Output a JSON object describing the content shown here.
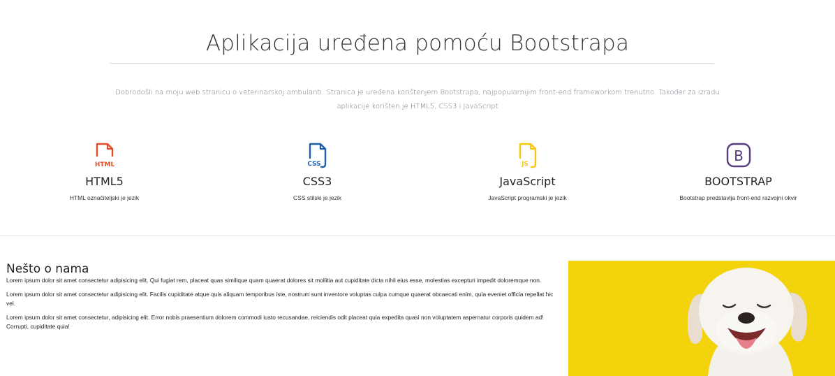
{
  "hero": {
    "title": "Aplikacija uređena pomoću Bootstrapa",
    "lead": "Dobrodošli na moju web stranicu o veterinarskoj ambulanti. Stranica je uređena korištenjem Bootstrapa, najpopularnijim front-end frameworkom trenutno. Također za izradu aplikacije korišten je HTML5, CSS3 i JavaScript"
  },
  "features": [
    {
      "icon": "html5-icon",
      "icon_label": "HTML",
      "title": "HTML5",
      "desc": "HTML označiteljski je jezik",
      "color": "#e44d26"
    },
    {
      "icon": "css3-icon",
      "icon_label": "CSS",
      "title": "CSS3",
      "desc": "CSS stilski je jezik",
      "color": "#1f5fa7"
    },
    {
      "icon": "javascript-icon",
      "icon_label": "JS",
      "title": "JavaScript",
      "desc": "JavaScript programski je jezik",
      "color": "#f7c70f"
    },
    {
      "icon": "bootstrap-icon",
      "icon_label": "B",
      "title": "BOOTSTRAP",
      "desc": "Bootstrap predstavlja front-end razvojni okvir",
      "color": "#563d7c"
    }
  ],
  "about": {
    "heading": "Nešto o nama",
    "paragraphs": [
      "Lorem ipsum dolor sit amet consectetur adipisicing elit. Qui fugiat rem, placeat quas similique quam quaerat dolores sit mollitia aut cupiditate dicta nihil eius esse, molestias excepturi impedit doloremque non.",
      "Lorem ipsum dolor sit amet consectetur adipisicing elit. Facilis cupiditate atque quis aliquam temporibus iste, nostrum sunt inventore voluptas culpa cumque quaerat obcaecati enim, quia eveniet officia repellat hic vel.",
      "Lorem ipsum dolor sit amet consectetur, adipisicing elit. Error nobis praesentium dolorem commodi iusto recusandae, reiciendis odit placeat quia expedita quasi non voluptatem aspernatur corporis quidem ad! Corrupti, cupiditate quia!"
    ],
    "image_bg": "#f2d30c"
  }
}
